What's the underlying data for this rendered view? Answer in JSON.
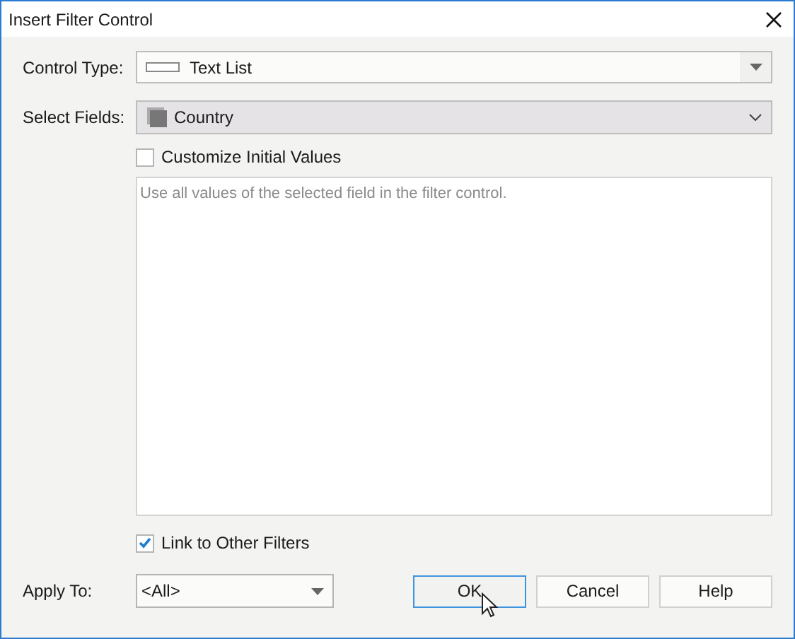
{
  "window": {
    "title": "Insert Filter Control"
  },
  "control_type": {
    "label": "Control Type:",
    "value": "Text List"
  },
  "select_fields": {
    "label": "Select Fields:",
    "value": "Country"
  },
  "checkboxes": [
    {
      "label": "Customize Initial Values",
      "checked": false
    }
  ],
  "description": "Use all values of the selected field in the filter control.",
  "link_option": {
    "label": "Link to Other Filters",
    "checked": true
  },
  "apply_to": {
    "label": "Apply To:",
    "value": "<All>"
  },
  "buttons": [
    {
      "label": "OK",
      "selected": true
    },
    {
      "label": "Cancel",
      "selected": false
    },
    {
      "label": "Help",
      "selected": false
    }
  ]
}
